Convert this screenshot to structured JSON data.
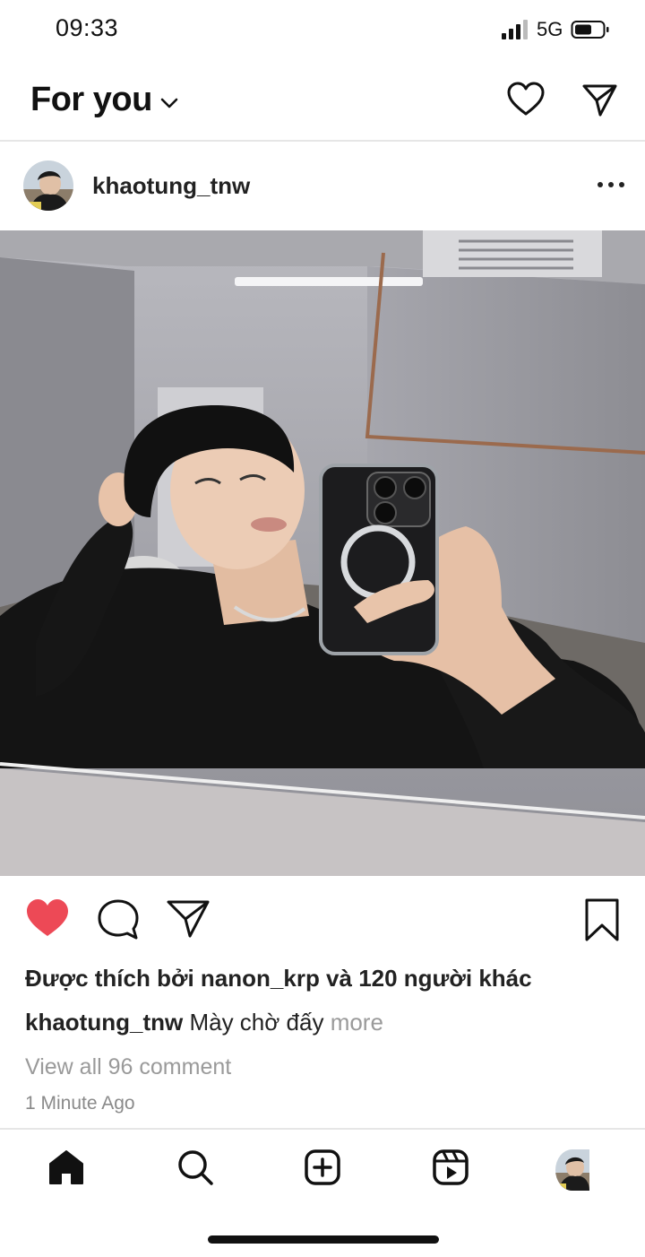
{
  "status_bar": {
    "time": "09:33",
    "network": "5G",
    "signal_icon": "cellular-signal-icon",
    "battery_icon": "battery-icon"
  },
  "top_bar": {
    "title": "For you",
    "dropdown_icon": "chevron-down-icon",
    "notifications_icon": "heart-outline-icon",
    "direct_icon": "paper-plane-icon"
  },
  "post": {
    "username": "khaotung_tnw",
    "more_icon": "more-horizontal-icon",
    "actions": {
      "like_icon": "heart-filled-icon",
      "like_color": "#ed4956",
      "comment_icon": "comment-icon",
      "share_icon": "paper-plane-icon",
      "save_icon": "bookmark-icon"
    },
    "likes_text": "Được thích bởi nanon_krp và 120 người khác",
    "caption_user": "khaotung_tnw",
    "caption_text": "Mày chờ đấy",
    "caption_more": "more",
    "view_comments": "View all 96 comment",
    "time_ago": "1 Minute Ago"
  },
  "bottom_nav": {
    "items": [
      {
        "name": "home",
        "icon": "home-icon"
      },
      {
        "name": "search",
        "icon": "search-icon"
      },
      {
        "name": "create",
        "icon": "plus-square-icon"
      },
      {
        "name": "reels",
        "icon": "reels-icon"
      },
      {
        "name": "profile",
        "icon": "avatar"
      }
    ]
  }
}
